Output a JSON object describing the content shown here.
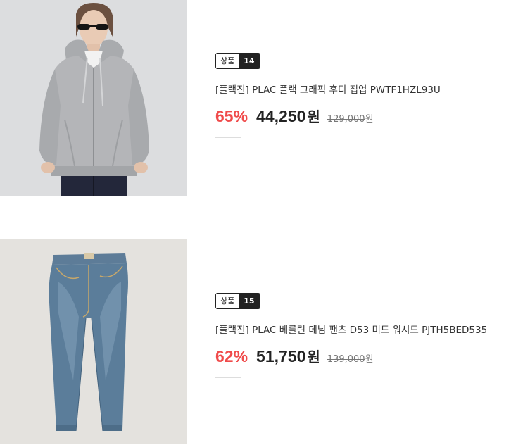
{
  "products": [
    {
      "image": "grey-zip-hoodie-photo",
      "badge_label": "상품",
      "badge_number": "14",
      "title": "[플랙진] PLAC 플랙 그래픽 후디 집업 PWTF1HZL93U",
      "discount": "65%",
      "price": "44,250",
      "currency": "원",
      "original_price": "129,000",
      "original_currency": "원"
    },
    {
      "image": "blue-denim-jeans-photo",
      "badge_label": "상품",
      "badge_number": "15",
      "title": "[플랙진] PLAC 베를린 데님 팬츠 D53 미드 워시드 PJTH5BED535",
      "discount": "62%",
      "price": "51,750",
      "currency": "원",
      "original_price": "139,000",
      "original_currency": "원"
    }
  ],
  "colors": {
    "discount": "#f04b4b",
    "text": "#222222",
    "muted": "#777777"
  }
}
